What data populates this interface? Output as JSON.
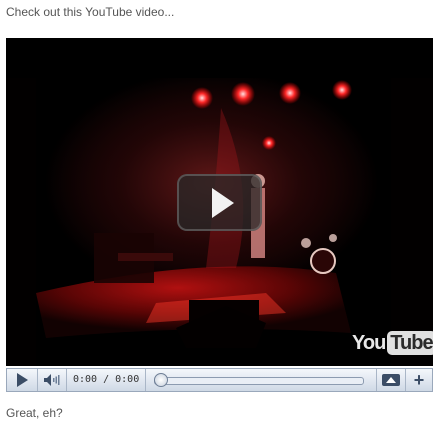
{
  "post": {
    "intro_text": "Check out this YouTube video...",
    "outro_text": "Great, eh?"
  },
  "player": {
    "logo_you": "You",
    "logo_tube": "Tube",
    "time_display": "0:00 / 0:00",
    "progress": 0,
    "plus_label": "+",
    "colors": {
      "control_bar": "#cfd9e6",
      "control_icon": "#3b4d66",
      "stage_light": "#e01a1a"
    },
    "icons": {
      "play": "play-icon",
      "volume": "volume-icon",
      "expand": "expand-icon",
      "overlay_play": "play-overlay-icon"
    }
  }
}
